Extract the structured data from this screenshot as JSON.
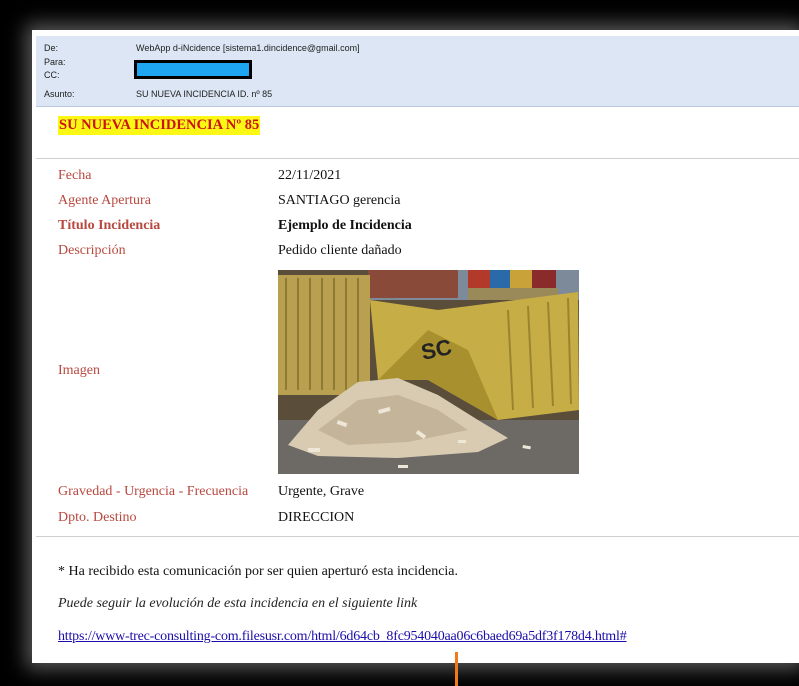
{
  "email": {
    "from_label": "De:",
    "from_value": "WebApp d-iNcidence [sistema1.dincidence@gmail.com]",
    "to_label": "Para:",
    "cc_label": "CC:",
    "subject_label": "Asunto:",
    "subject_value": "SU NUEVA INCIDENCIA ID. nº 85"
  },
  "incident": {
    "heading": "SU NUEVA INCIDENCIA Nº 85",
    "fields": [
      {
        "label": "Fecha",
        "value": "22/11/2021"
      },
      {
        "label": "Agente Apertura",
        "value": "SANTIAGO gerencia"
      },
      {
        "label": "Título Incidencia",
        "value": "Ejemplo de Incidencia"
      },
      {
        "label": "Descripción",
        "value": "Pedido cliente dañado"
      },
      {
        "label": "Imagen"
      },
      {
        "label": "Gravedad - Urgencia - Frecuencia",
        "value": "Urgente, Grave"
      },
      {
        "label": "Dpto. Destino",
        "value": "DIRECCION"
      }
    ]
  },
  "footer": {
    "notice": "* Ha recibido esta comunicación por ser quien aperturó esta incidencia.",
    "follow_text": "Puede seguir la evolución de esta incidencia en el siguiente link",
    "link": "https://www-trec-consulting-com.filesusr.com/html/6d64cb_8fc954040aa06c6baed69a5df3f178d4.html#"
  },
  "colors": {
    "label_red": "#b8483e",
    "heading_highlight": "#fcf816",
    "header_bg": "#dce6f4",
    "redaction": "#1ea6f2",
    "link": "#1a0dab"
  }
}
